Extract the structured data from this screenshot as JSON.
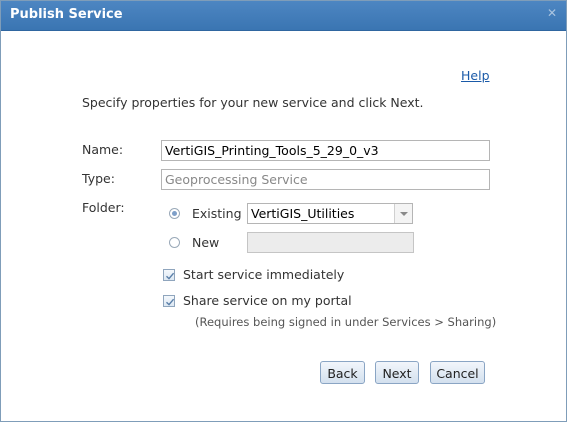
{
  "dialog": {
    "title": "Publish Service",
    "close_glyph": "✕",
    "help_label": "Help",
    "instructions": "Specify properties for your new service and click Next."
  },
  "form": {
    "name_label": "Name:",
    "name_value": "VertiGIS_Printing_Tools_5_29_0_v3",
    "type_label": "Type:",
    "type_value": "Geoprocessing Service",
    "folder_label": "Folder:",
    "existing_label": "Existing",
    "existing_selected": true,
    "existing_value": "VertiGIS_Utilities",
    "new_label": "New",
    "new_value": "",
    "start_service_label": "Start service immediately",
    "start_service_checked": true,
    "share_label": "Share service on my portal",
    "share_checked": true,
    "share_note": "(Requires being signed in under Services > Sharing)"
  },
  "buttons": {
    "back": "Back",
    "next": "Next",
    "cancel": "Cancel"
  },
  "colors": {
    "titlebar": "#3f7bb8",
    "link": "#1a5aa8",
    "button_border": "#8aa5c4"
  }
}
